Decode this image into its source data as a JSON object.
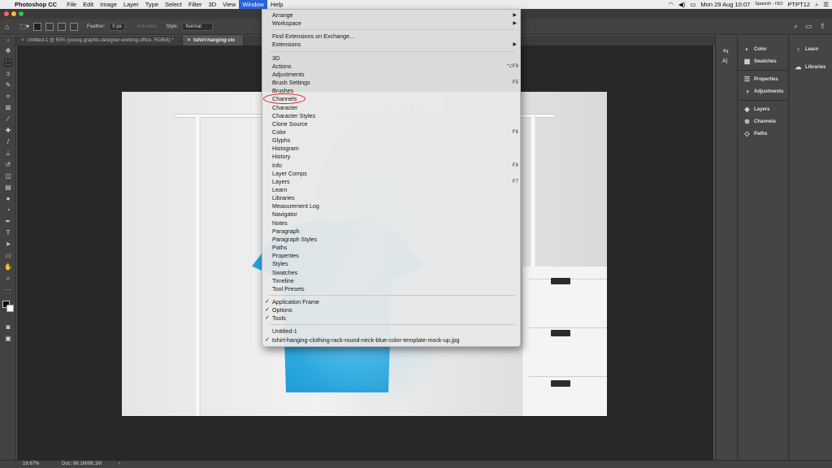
{
  "menubar": {
    "app_name": "Photoshop CC",
    "items": [
      "File",
      "Edit",
      "Image",
      "Layer",
      "Type",
      "Select",
      "Filter",
      "3D",
      "View",
      "Window",
      "Help"
    ],
    "active_item": "Window",
    "date_time": "Mon 29 Aug  10:07",
    "input_source": "Spanish - ISO",
    "user": "PTPT12"
  },
  "options_bar": {
    "feather_label": "Feather:",
    "feather_value": "0 px",
    "anti_alias_label": "Anti-alias",
    "style_label": "Style:",
    "style_value": "Normal"
  },
  "doc_tabs": [
    {
      "label": "Untitled-1 @ 50% (young-graphic-designer-working-office, RGB/8) *",
      "active": false
    },
    {
      "label": "tshirt-hanging-clo",
      "active": true
    }
  ],
  "window_menu": {
    "items": [
      {
        "label": "Arrange",
        "submenu": true
      },
      {
        "label": "Workspace",
        "submenu": true
      },
      {
        "separator": true
      },
      {
        "label": "Find Extensions on Exchange..."
      },
      {
        "label": "Extensions",
        "submenu": true
      },
      {
        "separator": true
      },
      {
        "label": "3D"
      },
      {
        "label": "Actions",
        "shortcut": "⌥F9"
      },
      {
        "label": "Adjustments"
      },
      {
        "label": "Brush Settings",
        "shortcut": "F5"
      },
      {
        "label": "Brushes"
      },
      {
        "label": "Channels",
        "highlighted": true
      },
      {
        "label": "Character"
      },
      {
        "label": "Character Styles"
      },
      {
        "label": "Clone Source"
      },
      {
        "label": "Color",
        "shortcut": "F6"
      },
      {
        "label": "Glyphs"
      },
      {
        "label": "Histogram"
      },
      {
        "label": "History"
      },
      {
        "label": "Info",
        "shortcut": "F8"
      },
      {
        "label": "Layer Comps"
      },
      {
        "label": "Layers",
        "shortcut": "F7"
      },
      {
        "label": "Learn"
      },
      {
        "label": "Libraries"
      },
      {
        "label": "Measurement Log"
      },
      {
        "label": "Navigator"
      },
      {
        "label": "Notes"
      },
      {
        "label": "Paragraph"
      },
      {
        "label": "Paragraph Styles"
      },
      {
        "label": "Paths"
      },
      {
        "label": "Properties"
      },
      {
        "label": "Styles"
      },
      {
        "label": "Swatches"
      },
      {
        "label": "Timeline"
      },
      {
        "label": "Tool Presets"
      },
      {
        "separator": true
      },
      {
        "label": "Application Frame",
        "checked": true
      },
      {
        "label": "Options",
        "checked": true
      },
      {
        "label": "Tools",
        "checked": true
      },
      {
        "separator": true
      },
      {
        "label": "Untitled-1"
      },
      {
        "label": "tshirt-hanging-clothing-rack-round-neck-blue-color-template-mock-up.jpg",
        "checked": true
      }
    ]
  },
  "panels": {
    "group1": [
      {
        "label": "Color",
        "icon": "color-wheel-icon"
      },
      {
        "label": "Swatches",
        "icon": "swatches-grid-icon"
      }
    ],
    "group2": [
      {
        "label": "Properties",
        "icon": "properties-icon"
      },
      {
        "label": "Adjustments",
        "icon": "adjustments-icon"
      }
    ],
    "group3": [
      {
        "label": "Layers",
        "icon": "layers-icon"
      },
      {
        "label": "Channels",
        "icon": "channels-icon"
      },
      {
        "label": "Paths",
        "icon": "paths-icon"
      }
    ],
    "group4": [
      {
        "label": "Learn",
        "icon": "lightbulb-icon"
      },
      {
        "label": "Libraries",
        "icon": "libraries-icon"
      }
    ]
  },
  "status_bar": {
    "zoom": "16.67%",
    "doc_size": "Doc: 86.1M/86.1M",
    "arrow": "›"
  },
  "colors": {
    "menu_highlight": "#2b62d6",
    "annotation_circle": "#e01818",
    "shirt_blue": "#2aa8df"
  }
}
